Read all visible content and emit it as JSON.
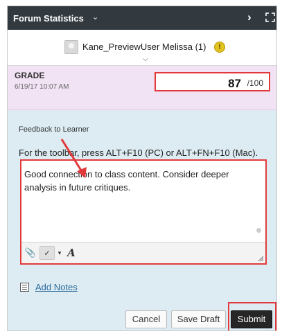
{
  "header": {
    "title": "Forum Statistics",
    "caret_icon": "chevron-down-icon",
    "next_icon": "chevron-right-icon",
    "expand_icon": "expand-icon",
    "background": "#333a3f"
  },
  "user": {
    "name": "Kane_PreviewUser Melissa (1)",
    "badge_icon": "warning-icon"
  },
  "grade": {
    "label": "GRADE",
    "date": "6/19/17 10:07 AM",
    "value": "87",
    "max": "/100"
  },
  "feedback": {
    "label": "Feedback to Learner",
    "instructions": "For the toolbar, press ALT+F10 (PC) or ALT+FN+F10 (Mac).",
    "text": "Good connection to class content.  Consider deeper analysis in future critiques."
  },
  "notes": {
    "link_label": "Add Notes"
  },
  "actions": {
    "cancel_label": "Cancel",
    "draft_label": "Save Draft",
    "submit_label": "Submit"
  },
  "colors": {
    "highlight": "#e23a3a",
    "grade_bg": "#f1e2f4",
    "panel_bg": "#dcecf2",
    "link": "#2b6a9c"
  }
}
